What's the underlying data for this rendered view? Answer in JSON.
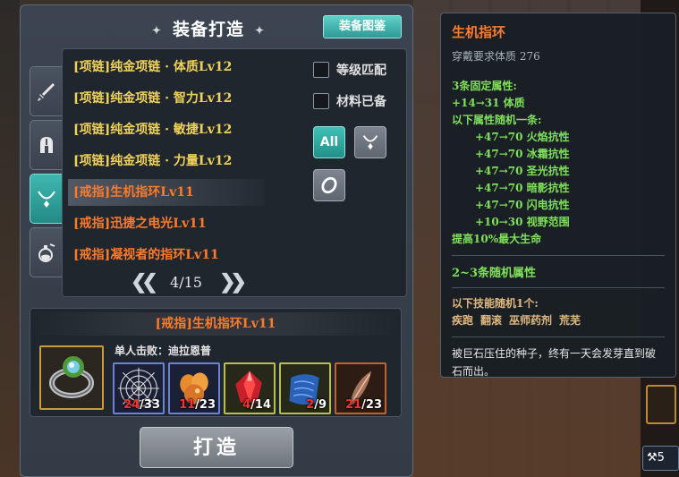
{
  "window": {
    "title": "装备打造",
    "atlas_button": "装备图鉴"
  },
  "side_tabs": [
    {
      "name": "weapon",
      "icon": "sword-icon",
      "active": false
    },
    {
      "name": "armor",
      "icon": "helmet-icon",
      "active": false
    },
    {
      "name": "accessory",
      "icon": "necklace-icon",
      "active": true
    },
    {
      "name": "consumable",
      "icon": "potion-icon",
      "active": false
    }
  ],
  "recipe_list": {
    "items": [
      {
        "label": "[项链]纯金项链 · 体质Lv12",
        "rarity": "yellow"
      },
      {
        "label": "[项链]纯金项链 · 智力Lv12",
        "rarity": "yellow"
      },
      {
        "label": "[项链]纯金项链 · 敏捷Lv12",
        "rarity": "yellow"
      },
      {
        "label": "[项链]纯金项链 · 力量Lv12",
        "rarity": "yellow"
      },
      {
        "label": "[戒指]生机指环Lv11",
        "rarity": "orange",
        "selected": true
      },
      {
        "label": "[戒指]迅捷之电光Lv11",
        "rarity": "orange"
      },
      {
        "label": "[戒指]凝视者的指环Lv11",
        "rarity": "orange"
      }
    ],
    "pager": {
      "current": "4/15",
      "prev_icon": "double-chevron-left-icon",
      "next_icon": "double-chevron-right-icon"
    }
  },
  "filters": {
    "level_match": "等级匹配",
    "materials_ready": "材料已备",
    "type_all": "All",
    "type_necklace_icon": "necklace-icon",
    "type_ring_icon": "ring-icon"
  },
  "recipe": {
    "header": "[戒指]生机指环Lv11",
    "monster_label": "单人击败：迪拉恩普",
    "result_icon": "ring-icon",
    "materials": [
      {
        "icon": "web-icon",
        "have": "24",
        "need": "/33",
        "frame": "blue"
      },
      {
        "icon": "egg-cluster-icon",
        "have": "11",
        "need": "/23",
        "frame": "blue"
      },
      {
        "icon": "red-crystal-icon",
        "have": "4",
        "need": "/14",
        "frame": "green"
      },
      {
        "icon": "blue-scroll-icon",
        "have": "2",
        "need": "/9",
        "frame": "green"
      },
      {
        "icon": "feather-icon",
        "have": "21",
        "need": "/23",
        "frame": "brown"
      }
    ],
    "craft_button": "打造"
  },
  "tooltip": {
    "title": "生机指环",
    "requirement": "穿戴要求体质  276",
    "fixed_header": "3条固定属性:",
    "fixed_stat": "+14→31  体质",
    "random_header": "以下属性随机一条:",
    "random_stats": [
      "+47→70  火焰抗性",
      "+47→70  冰霜抗性",
      "+47→70  圣光抗性",
      "+47→70  暗影抗性",
      "+47→70  闪电抗性",
      "+10→30  视野范围"
    ],
    "extra": "提高10%最大生命",
    "random_count": "2~3条随机属性",
    "skill_header": "以下技能随机1个:",
    "skills": [
      "疾跑",
      "翻滚",
      "巫师药剂",
      "荒芜"
    ],
    "description": "被巨石压住的种子，终有一天会发芽直到破石而出。"
  },
  "edge": {
    "chip_value": "5"
  },
  "colors": {
    "accent_teal": "#3fb7b0",
    "rarity_yellow": "#f0d25a",
    "rarity_orange": "#ff7a2a",
    "stat_green": "#7fe05a",
    "missing_red": "#ff3030"
  }
}
